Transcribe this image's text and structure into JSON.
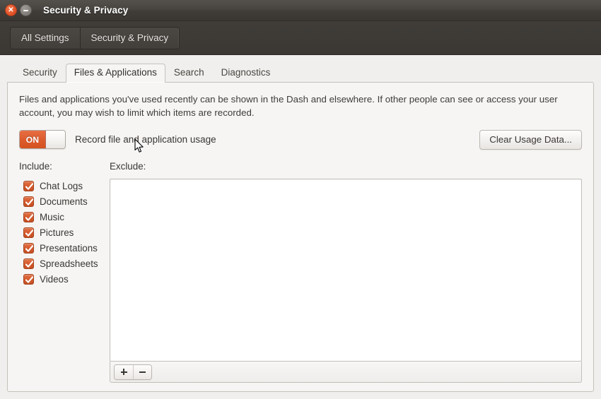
{
  "window": {
    "title": "Security & Privacy",
    "close_icon": "close-icon",
    "minimize_icon": "minimize-icon"
  },
  "toolbar": {
    "all_settings_label": "All Settings",
    "current_panel_label": "Security & Privacy"
  },
  "tabs": [
    {
      "label": "Security",
      "active": false
    },
    {
      "label": "Files & Applications",
      "active": true
    },
    {
      "label": "Search",
      "active": false
    },
    {
      "label": "Diagnostics",
      "active": false
    }
  ],
  "panel": {
    "description": "Files and applications you've used recently can be shown in the Dash and elsewhere. If other people can see or access your user account, you may wish to limit which items are recorded.",
    "toggle": {
      "state_label": "ON",
      "state": "on",
      "label": "Record file and application usage"
    },
    "clear_button_label": "Clear Usage Data...",
    "include": {
      "heading": "Include:",
      "items": [
        {
          "label": "Chat Logs",
          "checked": true
        },
        {
          "label": "Documents",
          "checked": true
        },
        {
          "label": "Music",
          "checked": true
        },
        {
          "label": "Pictures",
          "checked": true
        },
        {
          "label": "Presentations",
          "checked": true
        },
        {
          "label": "Spreadsheets",
          "checked": true
        },
        {
          "label": "Videos",
          "checked": true
        }
      ]
    },
    "exclude": {
      "heading": "Exclude:",
      "items": [],
      "add_button_label": "+",
      "remove_button_label": "−"
    }
  },
  "colors": {
    "accent_orange": "#dd5c2e",
    "titlebar_dark": "#403d39",
    "panel_background": "#f6f5f4",
    "window_background": "#f0efee"
  }
}
